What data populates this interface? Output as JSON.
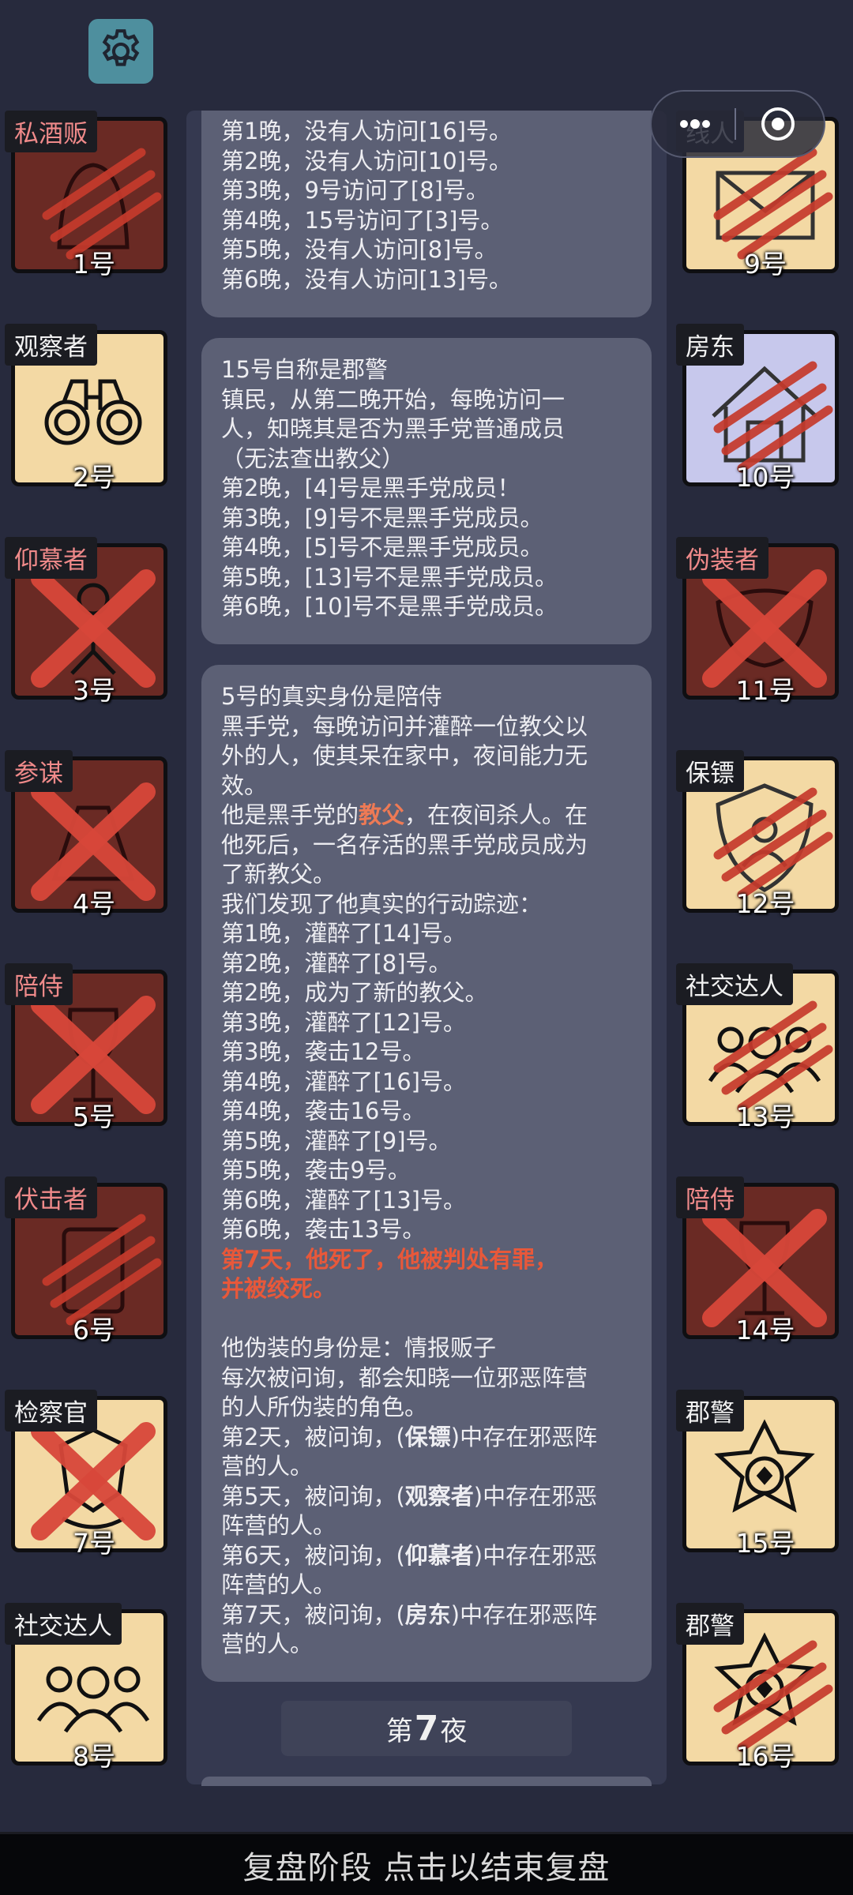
{
  "header": {
    "settings_icon": "gear-icon",
    "capsule_overlay_text": "..线人"
  },
  "players": [
    {
      "role": "私酒贩",
      "num": "1号",
      "team": "evil",
      "status": "clawed",
      "icon": "hooded-figure-icon"
    },
    {
      "role": "观察者",
      "num": "2号",
      "team": "town",
      "status": "alive",
      "icon": "binoculars-icon"
    },
    {
      "role": "仰慕者",
      "num": "3号",
      "team": "evil",
      "status": "crossed",
      "icon": "rose-bouquet-icon"
    },
    {
      "role": "参谋",
      "num": "4号",
      "team": "evil",
      "status": "crossed",
      "icon": "strategist-icon"
    },
    {
      "role": "陪侍",
      "num": "5号",
      "team": "evil",
      "status": "crossed",
      "icon": "wine-glass-icon"
    },
    {
      "role": "伏击者",
      "num": "6号",
      "team": "evil",
      "status": "clawed",
      "icon": "ambusher-icon"
    },
    {
      "role": "检察官",
      "num": "7号",
      "team": "town",
      "status": "crossed",
      "icon": "badge-emblem-icon"
    },
    {
      "role": "社交达人",
      "num": "8号",
      "team": "town",
      "status": "alive",
      "icon": "group-people-icon"
    },
    {
      "role": "线人",
      "num": "9号",
      "team": "town",
      "status": "clawed",
      "icon": "envelope-icon"
    },
    {
      "role": "房东",
      "num": "10号",
      "team": "town",
      "status": "clawed",
      "icon": "house-icon"
    },
    {
      "role": "伪装者",
      "num": "11号",
      "team": "evil",
      "status": "crossed",
      "icon": "mask-icon"
    },
    {
      "role": "保镖",
      "num": "12号",
      "team": "town",
      "status": "clawed",
      "icon": "shield-person-icon"
    },
    {
      "role": "社交达人",
      "num": "13号",
      "team": "town",
      "status": "clawed",
      "icon": "group-people-icon"
    },
    {
      "role": "陪侍",
      "num": "14号",
      "team": "evil",
      "status": "crossed",
      "icon": "wine-glass-icon"
    },
    {
      "role": "郡警",
      "num": "15号",
      "team": "town",
      "status": "alive",
      "icon": "sheriff-star-icon"
    },
    {
      "role": "郡警",
      "num": "16号",
      "team": "town",
      "status": "clawed",
      "icon": "sheriff-star-icon"
    }
  ],
  "log": {
    "block1": {
      "line0": "第1晚，没有人访问[16]号。",
      "line1": "第2晚，没有人访问[10]号。",
      "line2": "第3晚，9号访问了[8]号。",
      "line3": "第4晚，15号访问了[3]号。",
      "line4": "第5晚，没有人访问[8]号。",
      "line5": "第6晚，没有人访问[13]号。"
    },
    "block2": {
      "line0": "15号自称是郡警",
      "line1": "镇民，从第二晚开始，每晚访问一",
      "line2": "人，知晓其是否为黑手党普通成员",
      "line3": "（无法查出教父）",
      "line4": "第2晚，[4]号是黑手党成员！",
      "line5": "第3晚，[9]号不是黑手党成员。",
      "line6": "第4晚，[5]号不是黑手党成员。",
      "line7": "第5晚，[13]号不是黑手党成员。",
      "line8": "第6晚，[10]号不是黑手党成员。"
    },
    "block3": {
      "line0": "5号的真实身份是陪侍",
      "line1": "黑手党，每晚访问并灌醉一位教父以",
      "line2": "外的人，使其呆在家中，夜间能力无",
      "line3": "效。",
      "line4_a": "他是黑手党的",
      "line4_b": "教父",
      "line4_c": "，在夜间杀人。在",
      "line5": "他死后，一名存活的黑手党成员成为",
      "line6": "了新教父。",
      "line7": "我们发现了他真实的行动踪迹：",
      "line8": "第1晚，灌醉了[14]号。",
      "line9": "第2晚，灌醉了[8]号。",
      "line10": "第2晚，成为了新的教父。",
      "line11": "第3晚，灌醉了[12]号。",
      "line12": "第3晚，袭击12号。",
      "line13": "第4晚，灌醉了[16]号。",
      "line14": "第4晚，袭击16号。",
      "line15": "第5晚，灌醉了[9]号。",
      "line16": "第5晚，袭击9号。",
      "line17": "第6晚，灌醉了[13]号。",
      "line18": "第6晚，袭击13号。",
      "line19": "第7天，他死了，他被判处有罪，",
      "line20": "并被绞死。",
      "line21": "他伪装的身份是：情报贩子",
      "line22": "每次被问询，都会知晓一位邪恶阵营",
      "line23": "的人所伪装的角色。",
      "line24_a": "第2天，被问询，(",
      "line24_b": "保镖",
      "line24_c": ")中存在邪恶阵",
      "line25": "营的人。",
      "line26_a": "第5天，被问询，(",
      "line26_b": "观察者",
      "line26_c": ")中存在邪恶",
      "line27": "阵营的人。",
      "line28_a": "第6天，被问询，(",
      "line28_b": "仰慕者",
      "line28_c": ")中存在邪恶",
      "line29": "阵营的人。",
      "line30_a": "第7天，被问询，(",
      "line30_b": "房东",
      "line30_c": ")中存在邪恶阵",
      "line31": "营的人。"
    }
  },
  "night_button": {
    "prefix": "第",
    "number": "7",
    "suffix": "夜"
  },
  "bottom_bar": {
    "text": "复盘阶段 点击以结束复盘"
  },
  "colors": {
    "background": "#272a3d",
    "panel": "#5c6075",
    "highlight_red": "#e8583a",
    "claw": "#c53a2c"
  }
}
